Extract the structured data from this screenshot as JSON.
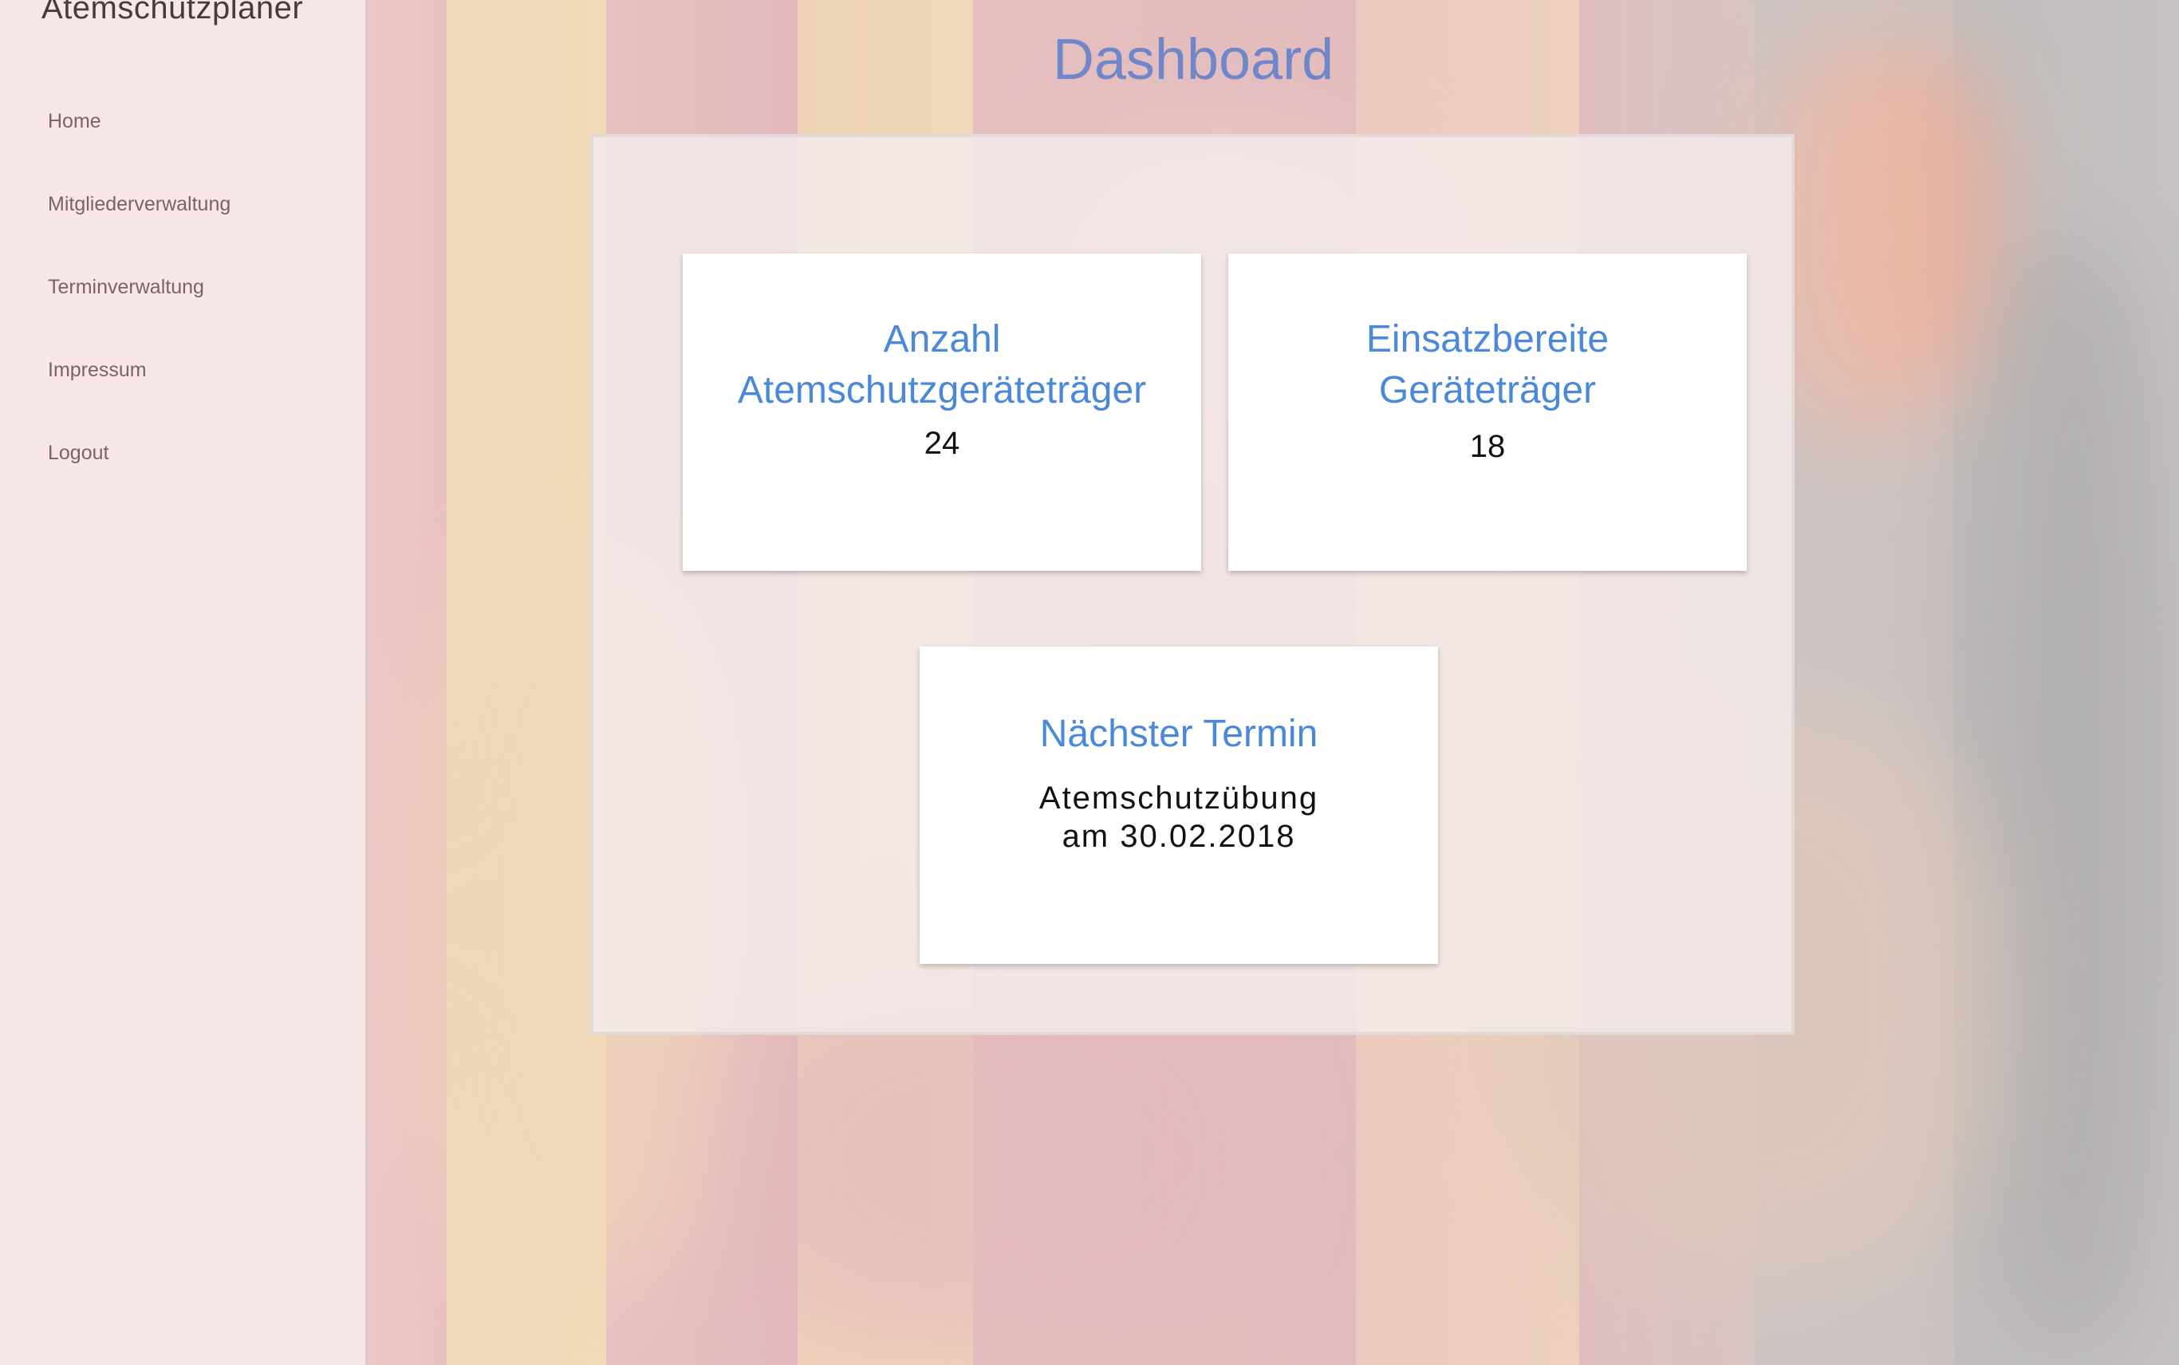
{
  "app": {
    "brand": "Atemschutzplaner"
  },
  "sidebar": {
    "items": [
      {
        "label": "Home"
      },
      {
        "label": "Mitgliederverwaltung"
      },
      {
        "label": "Terminverwaltung"
      },
      {
        "label": "Impressum"
      },
      {
        "label": "Logout"
      }
    ]
  },
  "main": {
    "title": "Dashboard",
    "cards": [
      {
        "title_line1": "Anzahl",
        "title_line2": "Atemschutzgeräteträger",
        "value": "24"
      },
      {
        "title_line1": "Einsatzbereite",
        "title_line2": "Geräteträger",
        "value": "18"
      },
      {
        "title": "Nächster Termin",
        "value_line1": "Atemschutzübung",
        "value_line2": "am 30.02.2018"
      }
    ]
  },
  "colors": {
    "title": "#6f86c8",
    "card_title": "#4a88da",
    "card_background": "#ffffff"
  }
}
